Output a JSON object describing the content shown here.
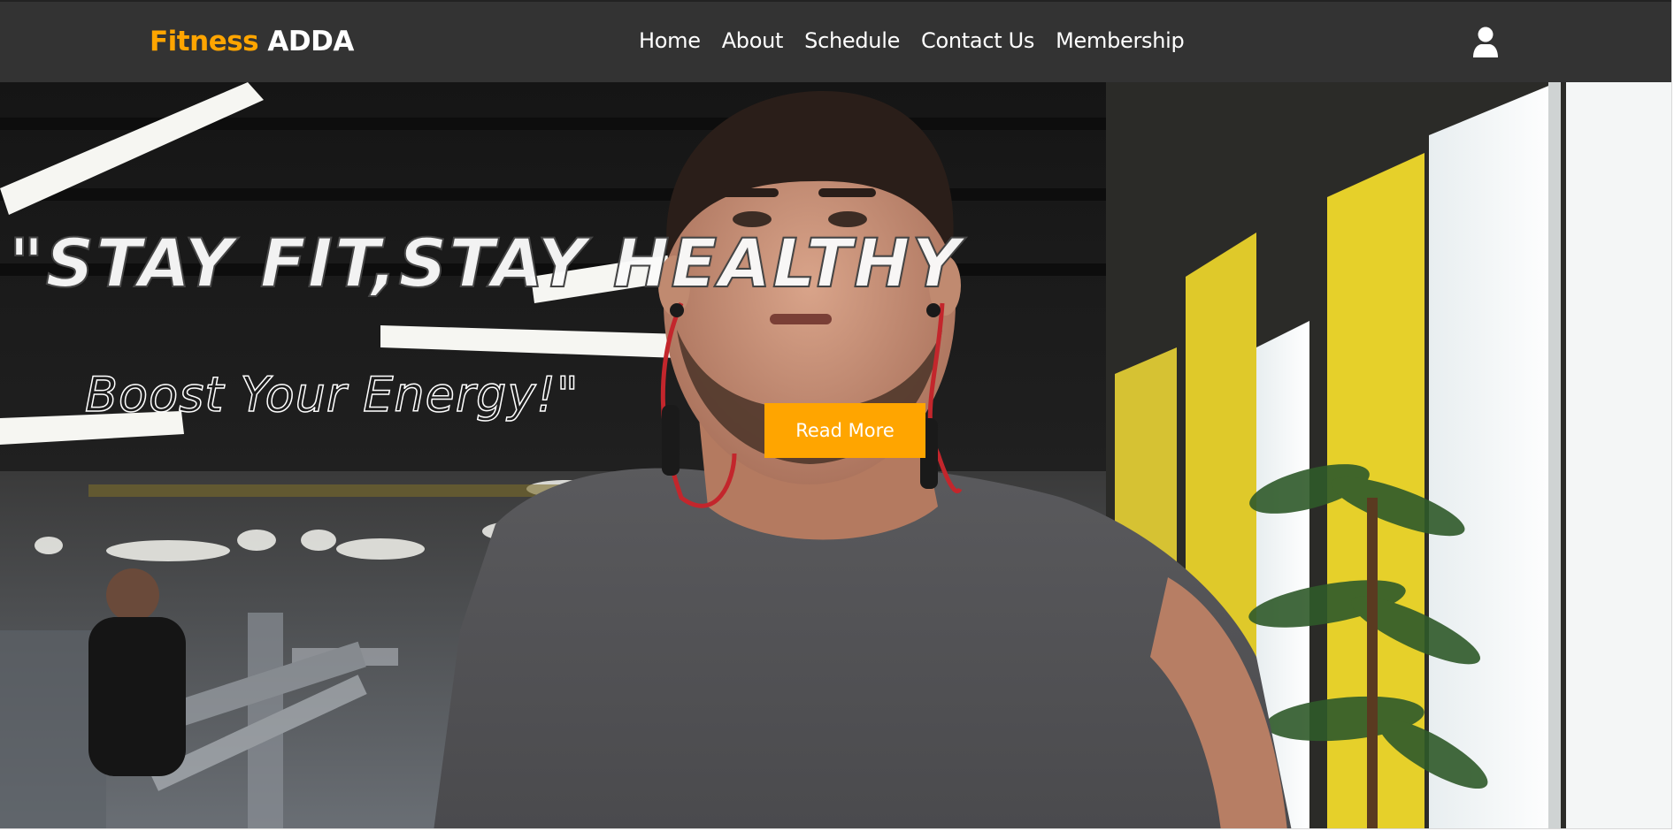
{
  "brand": {
    "part1": "Fitness",
    "part2": "ADDA"
  },
  "nav": {
    "items": [
      "Home",
      "About",
      "Schedule",
      "Contact Us",
      "Membership"
    ]
  },
  "header": {
    "user_icon": "user-icon"
  },
  "hero": {
    "headline": "\"STAY FIT,STAY HEALTHY",
    "subline": "Boost Your Energy!\"",
    "cta_label": "Read More"
  },
  "colors": {
    "accent": "#ffa500",
    "navbar": "#333333",
    "text": "#ffffff"
  }
}
